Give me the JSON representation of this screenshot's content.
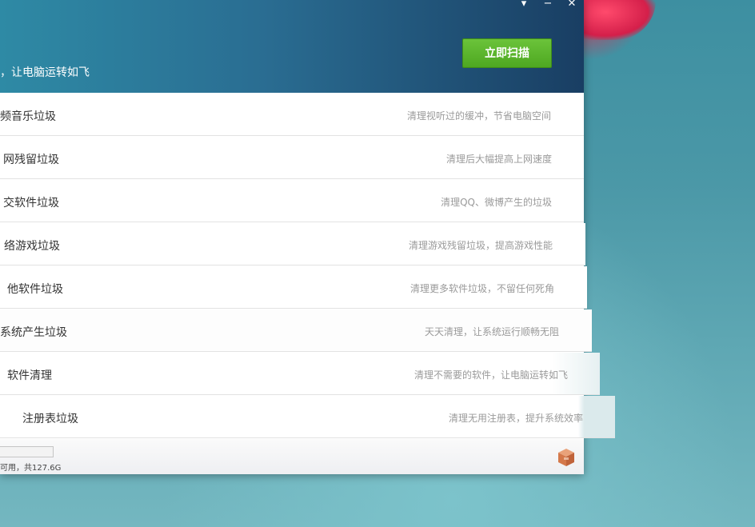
{
  "header": {
    "title_fragment": "",
    "subtitle": "，让电脑运转如飞",
    "scan_button": "立即扫描"
  },
  "window_controls": {
    "menu": "▾",
    "minimize": "−",
    "close": "✕"
  },
  "items": [
    {
      "name": "视频音乐垃圾",
      "visible_name": "频音乐垃圾",
      "desc": "清理视听过的缓冲，节省电脑空间"
    },
    {
      "name": "上网残留垃圾",
      "visible_name": "网残留垃圾",
      "desc": "清理后大幅提高上网速度"
    },
    {
      "name": "社交软件垃圾",
      "visible_name": "交软件垃圾",
      "desc": "清理QQ、微博产生的垃圾"
    },
    {
      "name": "网络游戏垃圾",
      "visible_name": "络游戏垃圾",
      "desc": "清理游戏残留垃圾，提高游戏性能"
    },
    {
      "name": "其他软件垃圾",
      "visible_name": "他软件垃圾",
      "desc": "清理更多软件垃圾，不留任何死角"
    },
    {
      "name": "系统产生垃圾",
      "visible_name": "系统产生垃圾",
      "desc": "天天清理，让系统运行顺畅无阻"
    },
    {
      "name": "软件清理",
      "visible_name": "软件清理",
      "desc": "清理不需要的软件，让电脑运转如飞"
    },
    {
      "name": "注册表垃圾",
      "visible_name": "注册表垃圾",
      "desc": "清理无用注册表，提升系统效率"
    }
  ],
  "footer": {
    "disk_text": "可用，共127.6G",
    "disk_usage_fraction": 0.0
  },
  "icons": {
    "box": "package-box-icon"
  }
}
